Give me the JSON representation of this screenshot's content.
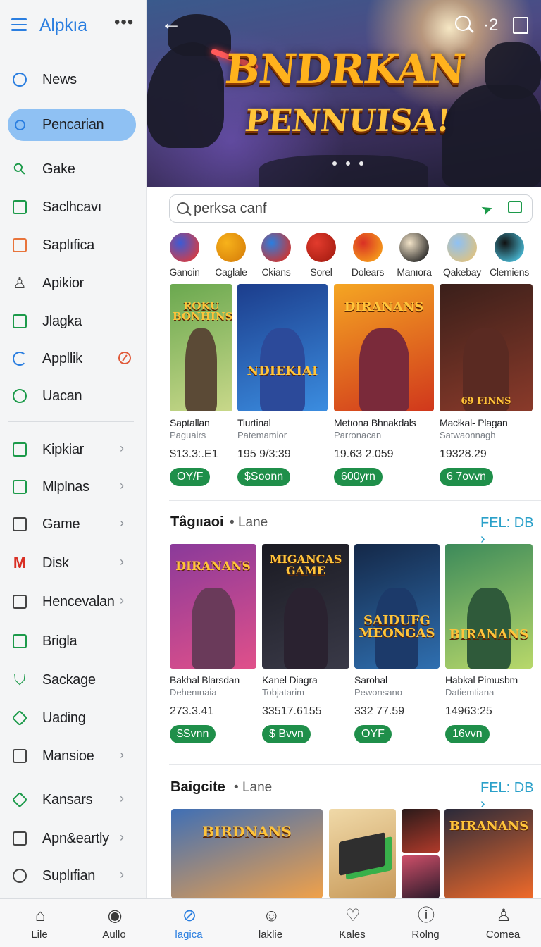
{
  "app": {
    "title": "Alpkıa",
    "more": "•••"
  },
  "sidebar": {
    "items": [
      {
        "label": "News",
        "icon": "info-icon",
        "color": "#2a7ee0"
      },
      {
        "label": "Pencarian",
        "icon": "search-icon",
        "color": "#2a7ee0",
        "active": true
      },
      {
        "label": "Gake",
        "icon": "key-icon",
        "color": "#1c9a4a"
      },
      {
        "label": "Saclhcavı",
        "icon": "square-icon",
        "color": "#1c9a4a"
      },
      {
        "label": "Saplıfica",
        "icon": "square-icon",
        "color": "#e8743b"
      },
      {
        "label": "Apikior",
        "icon": "user-icon",
        "color": "#444444"
      },
      {
        "label": "Jlagka",
        "icon": "image-icon",
        "color": "#1c9a4a"
      },
      {
        "label": "Appllik",
        "icon": "refresh-icon",
        "color": "#2a7ee0"
      },
      {
        "label": "Uacan",
        "icon": "circle-icon",
        "color": "#1c9a4a"
      },
      {
        "label": "Kipkiar",
        "icon": "dice-icon",
        "color": "#1c9a4a"
      },
      {
        "label": "Mlplnas",
        "icon": "list-icon",
        "color": "#1c9a4a"
      },
      {
        "label": "Game",
        "icon": "square-icon",
        "color": "#444444"
      },
      {
        "label": "Disk",
        "icon": "mail-icon",
        "color": "#d93025"
      },
      {
        "label": "Hencevalan",
        "icon": "chart-icon",
        "color": "#444444"
      },
      {
        "label": "Brigla",
        "icon": "square-icon",
        "color": "#1c9a4a"
      },
      {
        "label": "Sackage",
        "icon": "shield-icon",
        "color": "#1c9a4a"
      },
      {
        "label": "Uading",
        "icon": "tag-icon",
        "color": "#1c9a4a"
      },
      {
        "label": "Mansioe",
        "icon": "square-icon",
        "color": "#444444"
      },
      {
        "label": "Kansars",
        "icon": "diamond-icon",
        "color": "#1c9a4a"
      },
      {
        "label": "Apn&eartly",
        "icon": "dice-icon",
        "color": "#444444"
      },
      {
        "label": "Suplıfian",
        "icon": "target-icon",
        "color": "#444444"
      }
    ]
  },
  "hero": {
    "title_line1": "BNDRKAN",
    "title_line2": "PENNUISA!",
    "count": "·2"
  },
  "search": {
    "value": "perksa canf"
  },
  "categories": [
    {
      "label": "Ganoin",
      "color1": "#3b5bd6",
      "color2": "#e03a3a"
    },
    {
      "label": "Caglale",
      "color1": "#f7b21b",
      "color2": "#d9820a"
    },
    {
      "label": "Ckians",
      "color1": "#2a7ee0",
      "color2": "#d93025"
    },
    {
      "label": "Sorel",
      "color1": "#e23b2d",
      "color2": "#a81d12"
    },
    {
      "label": "Dolears",
      "color1": "#d93025",
      "color2": "#f7a21b"
    },
    {
      "label": "Manıora",
      "color1": "#f2e3c8",
      "color2": "#222222"
    },
    {
      "label": "Qakebay",
      "color1": "#8fc1f3",
      "color2": "#e3c27a"
    },
    {
      "label": "Clemiens",
      "color1": "#111111",
      "color2": "#4cc3e0"
    }
  ],
  "featured": [
    {
      "name": "Saptallan",
      "sub": "Paguairs",
      "num": "$13.3:.E1",
      "btn": "OY/F",
      "art_title": "ROKU BONHINS",
      "c1": "#6aa84f",
      "c2": "#c9d88a",
      "fig": "#5b4a36"
    },
    {
      "name": "Tiurtinal",
      "sub": "Patemamior",
      "num": "195 9/3:39",
      "btn": "$Soonn",
      "art_title": "NDIEKIAI",
      "c1": "#1c3d8c",
      "c2": "#3b8de0",
      "fig": "#2c4a9a"
    },
    {
      "name": "Metıona Bhnakdals",
      "sub": "Parronacan",
      "num": "19.63 2.059",
      "btn": "600yrn",
      "art_title": "DIRANANS",
      "c1": "#f5a623",
      "c2": "#d0371c",
      "fig": "#7a2a3a"
    },
    {
      "name": "Macłkal- Plagan",
      "sub": "Satwaonnagh",
      "num": "19328.29",
      "btn": "6 7ovvn",
      "art_title": "69 FINNS",
      "c1": "#3a1f1a",
      "c2": "#8a3a2a",
      "fig": "#5a2a22"
    }
  ],
  "section1": {
    "title": "Tâgııaoi",
    "sub": "Lane",
    "link": "FEL: DB"
  },
  "section1_cards": [
    {
      "name": "Bakhal Blarsdan",
      "sub": "Dehenınaia",
      "num": "273.3.41",
      "btn": "$Svnn",
      "art_title": "DIRANANS",
      "c1": "#8a3a9a",
      "c2": "#e0508a",
      "fig": "#6a3a5a"
    },
    {
      "name": "Kanel Diagra",
      "sub": "Tobjatarim",
      "num": "33517.6155",
      "btn": "$ Bvvn",
      "art_title": "MIGANCAS GAME",
      "c1": "#1a1a22",
      "c2": "#3a3a48",
      "fig": "#2a2230"
    },
    {
      "name": "Sarohal",
      "sub": "Pewonsano",
      "num": "332 77.59",
      "btn": "OYF",
      "art_title": "SAIDUFG MEONGAS",
      "c1": "#142848",
      "c2": "#2f6fb0",
      "fig": "#1c3a6a"
    },
    {
      "name": "Habkal Pimusbm",
      "sub": "Datiemtiana",
      "num": "14963:25",
      "btn": "16vvn",
      "art_title": "BIRANANS",
      "c1": "#3c8a5a",
      "c2": "#b8d86a",
      "fig": "#2f5a3a"
    }
  ],
  "section2": {
    "title": "Baigcite",
    "sub": "Lane",
    "link": "FEL: DB"
  },
  "section2_art": [
    {
      "art_title": "BIRDNANS",
      "c1": "#3f6fb5",
      "c2": "#f0a14a"
    },
    {
      "art_title": "",
      "c1": "#f0d9a8",
      "c2": "#c89a5a"
    },
    {
      "art_title": "",
      "c1": "#2a1a1a",
      "c2": "#b03a2a"
    },
    {
      "art_title": "",
      "c1": "#d0506a",
      "c2": "#2a1a2a"
    },
    {
      "art_title": "BIRANANS",
      "c1": "#2a2a3a",
      "c2": "#f06a2a"
    }
  ],
  "bottom_nav": [
    {
      "label": "Lile",
      "icon": "home-icon"
    },
    {
      "label": "Aullo",
      "icon": "compass-icon"
    },
    {
      "label": "lagica",
      "icon": "search-icon",
      "active": true
    },
    {
      "label": "laklie",
      "icon": "face-icon"
    },
    {
      "label": "Kales",
      "icon": "heart-icon"
    },
    {
      "label": "Rolng",
      "icon": "info-icon"
    },
    {
      "label": "Comea",
      "icon": "user-icon"
    }
  ],
  "colors": {
    "accent": "#2a7ee0",
    "green": "#1f8f4a",
    "link": "#2aa0c9"
  }
}
